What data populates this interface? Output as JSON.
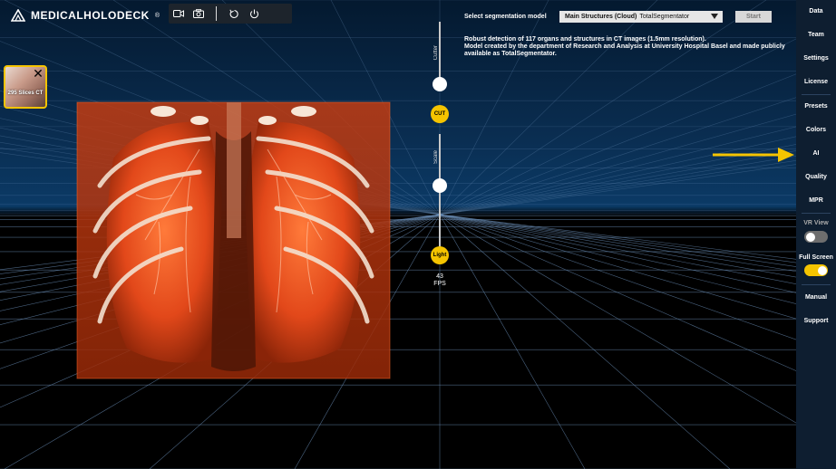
{
  "app": {
    "brand": "MEDICALHOLODECK",
    "trademark": "®"
  },
  "toolbar": {
    "buttons": [
      "video-camera-icon",
      "camera-icon",
      "reset-icon",
      "power-icon"
    ]
  },
  "series_thumb": {
    "label": "295 Slices CT",
    "close": "✕"
  },
  "view_controls": {
    "cutter_label": "Cutter",
    "cut_label": "CUT",
    "scale_label": "Scale",
    "light_label": "Light",
    "fps_value": "43",
    "fps_unit": "FPS"
  },
  "segmentation": {
    "label": "Select segmentation model",
    "model_name": "Main Structures (Cloud)",
    "model_sub": "TotalSegmentator",
    "start_label": "Start",
    "description_1": "Robust detection of 117 organs and structures in CT images (1.5mm resolution).",
    "description_2": "Model created by the department of Research and Analysis at University Hospital Basel and made publicly available as TotalSegmentator."
  },
  "sidebar": {
    "items": [
      {
        "label": "Data"
      },
      {
        "label": "Team"
      },
      {
        "label": "Settings"
      },
      {
        "label": "License"
      },
      {
        "label": "Presets"
      },
      {
        "label": "Colors"
      },
      {
        "label": "AI"
      },
      {
        "label": "Quality"
      },
      {
        "label": "MPR"
      }
    ],
    "vr_view_label": "VR View",
    "vr_view_on": false,
    "full_screen_label": "Full Screen",
    "full_screen_on": true,
    "manual_label": "Manual",
    "support_label": "Support"
  },
  "colors": {
    "accent": "#f5c400",
    "sidebar_bg": "#0e1e30",
    "volume": "#e0461a"
  }
}
